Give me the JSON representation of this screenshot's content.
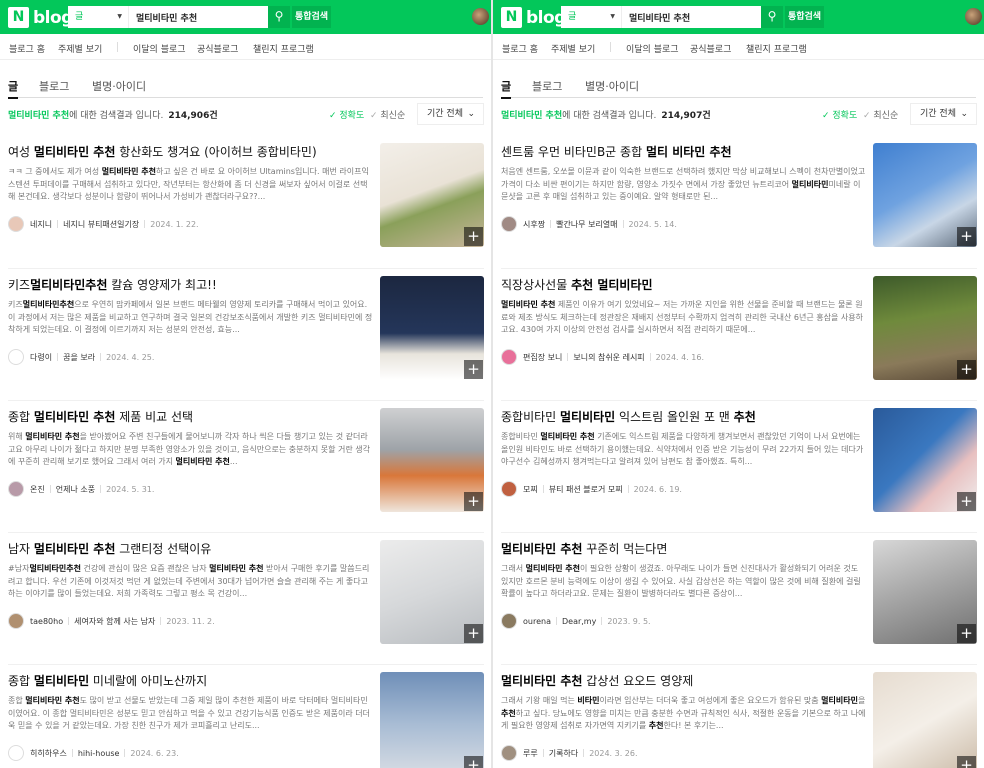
{
  "panels": [
    {
      "header": {
        "logo_n": "N",
        "logo_text": "blog",
        "search_scope": "글",
        "query": "멀티비타민 추천",
        "search_icon": "search-icon",
        "integrated_search": "통합검색"
      },
      "nav": [
        "블로그 홈",
        "주제별 보기",
        "이달의 블로그",
        "공식블로그",
        "챌린지 프로그램"
      ],
      "tabs": [
        "글",
        "블로그",
        "별명·아이디"
      ],
      "info": {
        "keyword": "멀티비타민 추천",
        "suffix": "에 대한 검색결과 입니다.",
        "count": "214,906건"
      },
      "sort": {
        "accuracy": "정확도",
        "latest": "최신순",
        "period": "기간 전체"
      },
      "results": [
        {
          "title": [
            [
              "여성 ",
              0
            ],
            [
              "멀티비타민 추천",
              1
            ],
            [
              " 항산화도 챙겨요 (아이허브 종합비타민)",
              0
            ]
          ],
          "snippet": [
            [
              "ㅋㅋ 그 중에서도 제가 여성 ",
              0
            ],
            [
              "멀티비타민 추천",
              1
            ],
            [
              "하고 싶은 건 바로 요 아이허브 Ultamins입니다. 매번 라이프익스텐션 투퍼데이를 구매해서 섭취하고 있다만, 작년부터는 항산화에 좀 더 신경을 써보자 싶어서 이걸로 선택해 본건데요. 생각보다 성분이나 함량이 뛰어나서 가성비가 괜찮더라구요??...",
              0
            ]
          ],
          "author": "네지니",
          "blog": "네지니 뷰티패션일기장",
          "date": "2024. 1. 22.",
          "avatar": "#e8c8b8",
          "thumb": "linear-gradient(160deg,#f3efe9 0%,#e9e2d6 45%,#8aa05a 60%,#c7b59a 100%)"
        },
        {
          "title": [
            [
              "키즈",
              0
            ],
            [
              "멀티비타민추천",
              1
            ],
            [
              " 칼슘 영양제가 최고!!",
              0
            ]
          ],
          "snippet": [
            [
              "키즈",
              0
            ],
            [
              "멀티비타민추천",
              1
            ],
            [
              "으로 우연히 맘카페에서 일본 브랜드 메타웰의 영양제 토리카를 구매해서 먹이고 있어요. 이 과정에서 저는 많은 제품을 비교하고 연구하며 결국 일본의 건강보조식품에서 개발한 키즈 멀티비타민에 정착하게 되었는데요. 이 결정에 이르기까지 저는 성분의 안전성, 효능...",
              0
            ]
          ],
          "author": "다령이",
          "blog": "꿈을 보라",
          "date": "2024. 4. 25.",
          "avatar": "#ffffff",
          "thumb": "linear-gradient(180deg,#1c2740 0%,#24365a 55%,#e8e4dc 75%,#ffffff 100%)"
        },
        {
          "title": [
            [
              "종합 ",
              0
            ],
            [
              "멀티비타민 추천",
              1
            ],
            [
              " 제품 비교 선택",
              0
            ]
          ],
          "snippet": [
            [
              "위해 ",
              0
            ],
            [
              "멀티비타민 추천",
              1
            ],
            [
              "을 받아봤어요 주변 친구들에게 물어보니까 각자 하나 씩은 다들 챙기고 있는 것 같더라고요 아무리 나이가 젊다고 하지만 분명 부족한 영양소가 있을 것이고, 음식만으로는 충분하지 못할 거란 생각에 꾸준히 관리해 보기로 했어요 그래서 여러 가지 ",
              0
            ],
            [
              "멀티비타민 추천",
              1
            ],
            [
              "...",
              0
            ]
          ],
          "author": "온진",
          "blog": "언제나 소풍",
          "date": "2024. 5. 31.",
          "avatar": "#b89aa8",
          "thumb": "linear-gradient(180deg,#cfd0d2 0%,#9ea3a8 40%,#d9773a 65%,#efe6dc 100%)"
        },
        {
          "title": [
            [
              "남자 ",
              0
            ],
            [
              "멀티비타민 추천",
              1
            ],
            [
              " 그랜티정 선택이유",
              0
            ]
          ],
          "snippet": [
            [
              "#남자",
              0
            ],
            [
              "멀티비타민추천",
              1
            ],
            [
              " 건강에 관심이 많은 요즘 괜찮은 남자 ",
              0
            ],
            [
              "멀티비타민 추천",
              1
            ],
            [
              " 받아서 구매한 후기를 말씀드리려고 합니다. 우선 기존에 이것저것 먹던 게 없었는데 주변에서 30대가 넘어가면 슬슬 관리해 주는 게 좋다고 하는 이야기를 많이 들었는데요. 저희 가족력도 그렇고 평소 목 건강이...",
              0
            ]
          ],
          "author": "tae80ho",
          "blog": "세여자와 함께 사는 남자",
          "date": "2023. 11. 2.",
          "avatar": "#b09070",
          "thumb": "linear-gradient(160deg,#ececec 0%,#d6d8da 50%,#b8bcc0 100%)"
        },
        {
          "title": [
            [
              "종합 ",
              0
            ],
            [
              "멀티비타민",
              1
            ],
            [
              " 미네랄에 아미노산까지",
              0
            ]
          ],
          "snippet": [
            [
              "종합 ",
              0
            ],
            [
              "멀티비타민 추천",
              1
            ],
            [
              "도 많이 받고 선물도 받았는데 그중 제일 많이 추천한 제품이 바로 닥터메타 멀티비타민이였어요. 이 종합 멀티비타민은 성분도 믿고 안심하고 먹을 수 있고 건강기능식품 인증도 받은 제품이라 더더욱 믿을 수 있을 거 같았는데요. 가장 친한 친구가 제가 코피흘리고 난리도...",
              0
            ]
          ],
          "author": "히히하우스",
          "blog": "hihi-house",
          "date": "2024. 6. 23.",
          "avatar": "#ffffff",
          "thumb": "linear-gradient(180deg,#6f8fb8 0%,#a8bcd4 50%,#d8dde4 100%)"
        }
      ]
    },
    {
      "header": {
        "logo_n": "N",
        "logo_text": "blog",
        "search_scope": "글",
        "query": "멀티비타민 추천",
        "search_icon": "search-icon",
        "integrated_search": "통합검색"
      },
      "nav": [
        "블로그 홈",
        "주제별 보기",
        "이달의 블로그",
        "공식블로그",
        "챌린지 프로그램"
      ],
      "tabs": [
        "글",
        "블로그",
        "별명·아이디"
      ],
      "info": {
        "keyword": "멀티비타민 추천",
        "suffix": "에 대한 검색결과 입니다.",
        "count": "214,907건"
      },
      "sort": {
        "accuracy": "정확도",
        "latest": "최신순",
        "period": "기간 전체"
      },
      "results": [
        {
          "title": [
            [
              "센트룸 우먼 비타민B군 종합 ",
              0
            ],
            [
              "멀티 비타민 추천",
              1
            ]
          ],
          "snippet": [
            [
              "처음엔 센트룸, 오쏘몰 이뮨과 같이 익숙한 브랜드로 선택하려 했지만 막상 비교해보니 스펙이 천차만별이었고 가격이 다소 비싼 편이기는 하지만 함량, 영양소 가짓수 면에서 가장 좋았던 뉴트리코어 ",
              0
            ],
            [
              "멀티비타민",
              1
            ],
            [
              "미네랄 이뮨샷을 고른 후 매일 섭취하고 있는 중이예요. 알약 형태로만 된...",
              0
            ]
          ],
          "author": "시후짱",
          "blog": "빨간나무 보리열매",
          "date": "2024. 5. 14.",
          "avatar": "#a08a84",
          "thumb": "linear-gradient(150deg,#3f7fd0 0%,#6fa2e0 45%,#c8d6e6 70%,#5a6878 100%)"
        },
        {
          "title": [
            [
              "직장상사선물 ",
              0
            ],
            [
              "추천 멀티비타민",
              1
            ]
          ],
          "snippet": [
            [
              "멀티비타민 추천",
              1
            ],
            [
              " 제품인 이유가 여기 있었네요~ 저는 가까운 지인을 위한 선물을 준비할 때 브랜드는 물론 원료와 제조 방식도 체크하는데 정관장은 재배지 선정부터 수확까지 엄격히 관리한 국내산 6년근 홍삼을 사용하고요. 430여 가지 이상의 안전성 검사를 실시하면서 직접 관리하기 때문에...",
              0
            ]
          ],
          "author": "편집장 보니",
          "blog": "보니의 참쉬운 레시피",
          "date": "2024. 4. 16.",
          "avatar": "#e8709a",
          "thumb": "linear-gradient(170deg,#3d5a2a 0%,#6f8a3c 40%,#8a7a5a 75%,#5a4a38 100%)"
        },
        {
          "title": [
            [
              "종합비타민 ",
              0
            ],
            [
              "멀티비타민",
              1
            ],
            [
              " 익스트림 올인원 포 맨 ",
              0
            ],
            [
              "추천",
              1
            ]
          ],
          "snippet": [
            [
              "종합비타민 ",
              0
            ],
            [
              "멀티비타민 추천",
              1
            ],
            [
              " 기존에도 익스트림 제품을 다양하게 챙겨보면서 괜찮았던 기억이 나서 요번에는 올인원 비타민도 바로 선택하기 용이했는데요. 식약처에서 인증 받은 기능성이 무려 22가지 들어 있는 데다가 야구선수 김혜성까지 챙겨먹는다고 알려져 있어 남편도 참 좋아했죠. 특히...",
              0
            ]
          ],
          "author": "모찌",
          "blog": "뷰티 패션 블로거 모찌",
          "date": "2024. 6. 19.",
          "avatar": "#c06040",
          "thumb": "linear-gradient(135deg,#2a5a9a 0%,#3a78c0 45%,#e8c0c0 70%,#f0f0f0 100%)"
        },
        {
          "title": [
            [
              "멀티비타민 추천",
              1
            ],
            [
              " 꾸준히 먹는다면",
              0
            ]
          ],
          "snippet": [
            [
              "그래서 ",
              0
            ],
            [
              "멀티비타민 추천",
              1
            ],
            [
              "이 필요한 상황이 생겼죠. 아무래도 나이가 들면 신진대사가 활성화되기 어려운 것도 있지만 호르몬 분비 능력에도 이상이 생길 수 있어요. 사실 갑상선은 하는 역할이 많은 것에 비해 질환에 걸릴 확률이 높다고 하더라고요. 문제는 질환이 발병하더라도 별다른 증상이...",
              0
            ]
          ],
          "author": "ourena",
          "blog": "Dear,my",
          "date": "2023. 9. 5.",
          "avatar": "#8a7a60",
          "thumb": "linear-gradient(160deg,#d8d8d8 0%,#a8a8a8 45%,#707070 100%)"
        },
        {
          "title": [
            [
              "멀티비타민 추천",
              1
            ],
            [
              " 갑상선 요오드 영양제",
              0
            ]
          ],
          "snippet": [
            [
              "그래서 기왕 매일 먹는 ",
              0
            ],
            [
              "비타민",
              1
            ],
            [
              "이라면 임산부는 더더욱 좋고 여성에게 좋은 요오드가 함유된 맞춤 ",
              0
            ],
            [
              "멀티비타민",
              1
            ],
            [
              "을 ",
              0
            ],
            [
              "추천",
              1
            ],
            [
              "하고 싶다. 당뇨에도 영향을 미치는 만큼 충분한 수면과 규칙적인 식사, 적절한 운동을 기본으로 하고 나에게 필요한 영양제 섭취로 자가면역 지키기를 ",
              0
            ],
            [
              "추천",
              1
            ],
            [
              "한다! 본 후기는...",
              0
            ]
          ],
          "author": "루루",
          "blog": "기록하다",
          "date": "2024. 3. 26.",
          "avatar": "#a09080",
          "thumb": "linear-gradient(150deg,#e6dcd0 0%,#f4efe8 50%,#c9b8a4 100%)"
        }
      ]
    }
  ]
}
